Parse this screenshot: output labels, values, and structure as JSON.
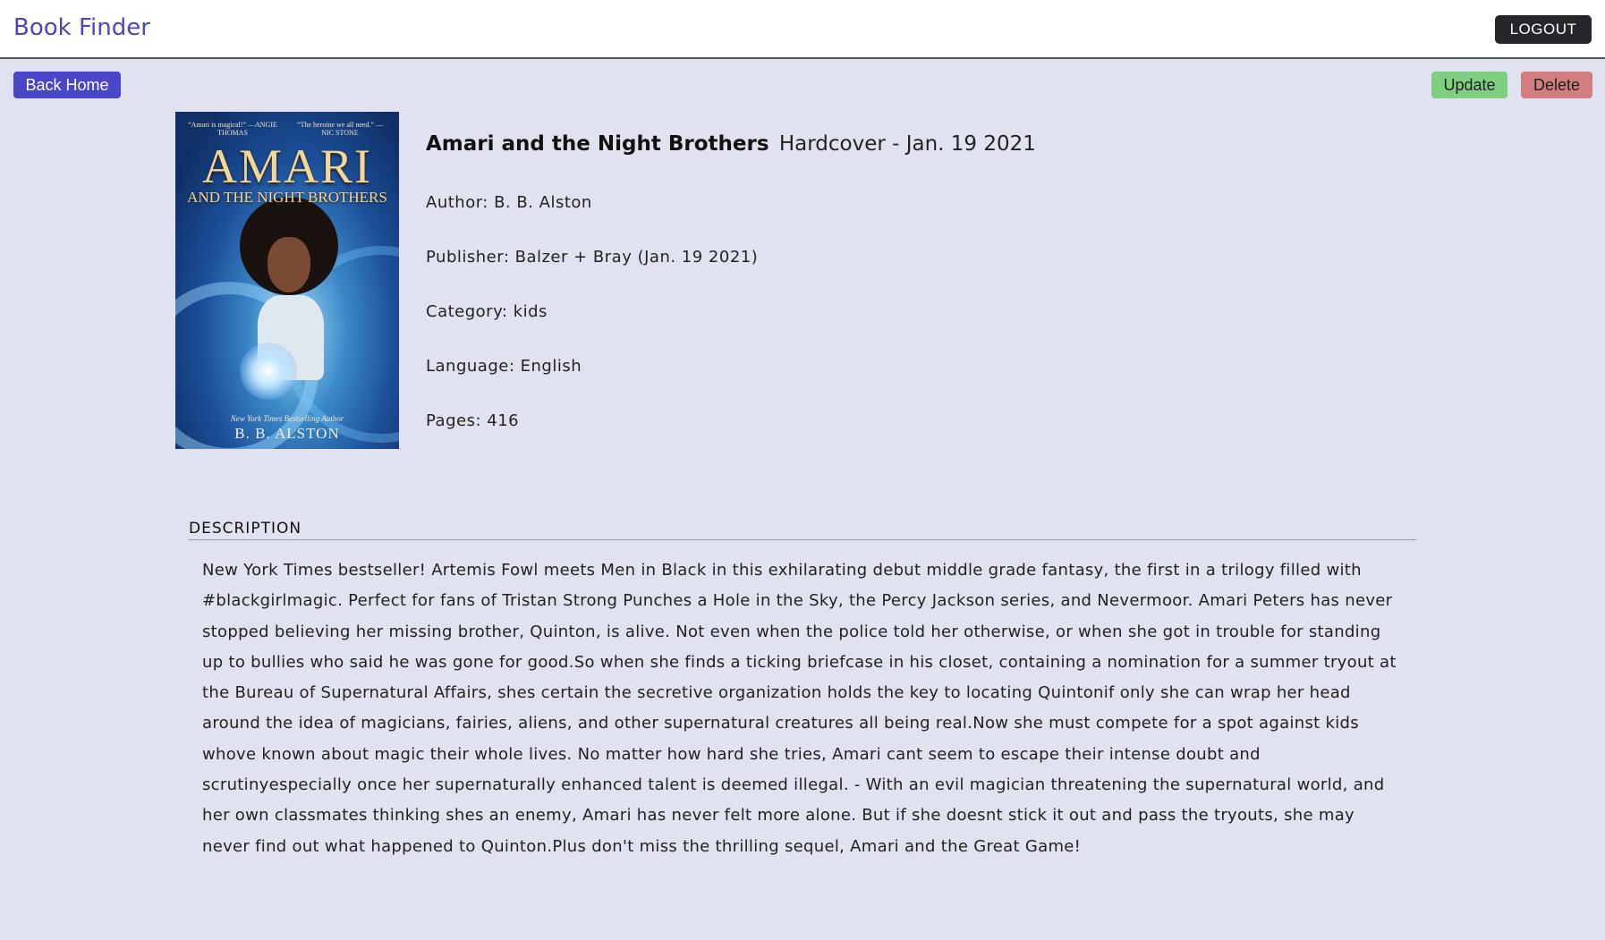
{
  "app": {
    "brand": "Book Finder",
    "logout_label": "LOGOUT"
  },
  "actions": {
    "back_home_label": "Back Home",
    "update_label": "Update",
    "delete_label": "Delete"
  },
  "cover": {
    "quote_left": "“Amari is magical!” —ANGIE THOMAS",
    "quote_right": "“The heroine we all need.” —NIC STONE",
    "title_main": "AMARI",
    "title_sub": "AND THE NIGHT BROTHERS",
    "tagline": "New York Times Bestselling Author",
    "author": "B. B. ALSTON"
  },
  "book": {
    "title": "Amari and the Night Brothers",
    "edition": "Hardcover - Jan. 19 2021",
    "author": "Author: B. B. Alston",
    "publisher": "Publisher: Balzer + Bray (Jan. 19 2021)",
    "category": "Category: kids",
    "language": "Language: English",
    "pages": "Pages: 416"
  },
  "description": {
    "heading": "DESCRIPTION",
    "text": "New York Times bestseller! Artemis Fowl meets Men in Black in this exhilarating debut middle grade fantasy, the first in a trilogy filled with #blackgirlmagic. Perfect for fans of Tristan Strong Punches a Hole in the Sky, the Percy Jackson series, and Nevermoor. Amari Peters has never stopped believing her missing brother, Quinton, is alive. Not even when the police told her otherwise, or when she got in trouble for standing up to bullies who said he was gone for good.So when she finds a ticking briefcase in his closet, containing a nomination for a summer tryout at the Bureau of Supernatural Affairs, shes certain the secretive organization holds the key to locating Quintonif only she can wrap her head around the idea of magicians, fairies, aliens, and other supernatural creatures all being real.Now she must compete for a spot against kids whove known about magic their whole lives. No matter how hard she tries, Amari cant seem to escape their intense doubt and scrutinyespecially once her supernaturally enhanced talent is deemed illegal. - With an evil magician threatening the supernatural world, and her own classmates thinking shes an enemy, Amari has never felt more alone. But if she doesnt stick it out and pass the tryouts, she may never find out what happened to Quinton.Plus don't miss the thrilling sequel, Amari and the Great Game!"
  }
}
